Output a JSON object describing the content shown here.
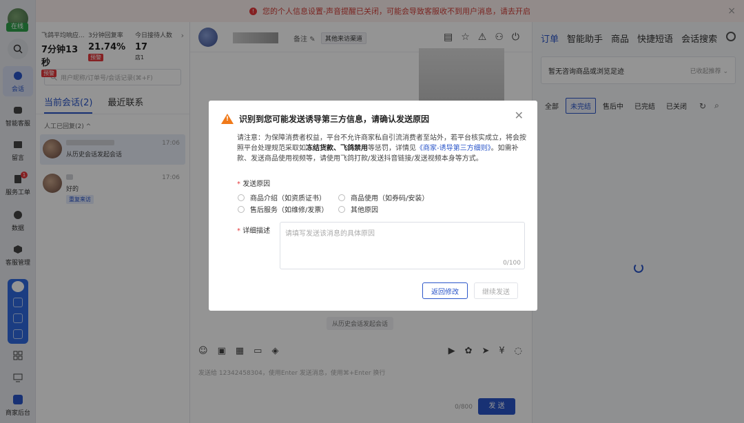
{
  "status": {
    "online": "在线"
  },
  "rail": [
    {
      "label": "会话",
      "icon": "chat-icon"
    },
    {
      "label": "智能客服",
      "icon": "ai-icon"
    },
    {
      "label": "留言",
      "icon": "mail-icon"
    },
    {
      "label": "服务工单",
      "icon": "ticket-icon",
      "badge": "1"
    },
    {
      "label": "数据",
      "icon": "pie-chart-icon"
    },
    {
      "label": "客服管理",
      "icon": "manage-icon"
    },
    {
      "label": "商家后台",
      "icon": "merchant-icon"
    }
  ],
  "topbar": {
    "message": "您的个人信息设置-声音提醒已关闭，可能会导致客服收不到用户消息，请去开启"
  },
  "stats": [
    {
      "label": "飞鸽平均响应...",
      "value": "7分钟13秒",
      "tag": "预警"
    },
    {
      "label": "3分钟回复率",
      "value": "21.74%",
      "tag": "预警"
    },
    {
      "label": "今日接待人数",
      "value": "17",
      "tag": "店1"
    }
  ],
  "search": {
    "placeholder": "用户昵称/订单号/会话记录(⌘+F)"
  },
  "tabs": {
    "current": "当前会话(2)",
    "recent": "最近联系"
  },
  "group": {
    "label": "人工已回复(2) ^"
  },
  "conversations": [
    {
      "message": "从历史会话发起会话",
      "time": "17:06"
    },
    {
      "message": "好的",
      "time": "17:06",
      "tag": "重复来访"
    }
  ],
  "chat": {
    "note": "备注",
    "channel": "其他来访渠道",
    "history_pill": "从历史会话发起会话",
    "input_placeholder": "发送给 12342458304，使用Enter 发送消息，使用⌘+Enter 换行",
    "count": "0/800",
    "send": "发 送"
  },
  "right": {
    "tabs": [
      "订单",
      "智能助手",
      "商品",
      "快捷短语",
      "会话搜索"
    ],
    "no_goods": "暂无咨询商品或浏览足迹",
    "recommend": "已收起推荐",
    "filters": [
      "全部",
      "未完结",
      "售后中",
      "已完结",
      "已关闭"
    ]
  },
  "modal": {
    "title": "识别到您可能发送诱导第三方信息，请确认发送原因",
    "notice_1": "请注意：为保障消费者权益，平台不允许商家私自引流消费者至站外，若平台核实成立，将会按照平台处理规范采取如",
    "notice_bold": "冻结货款、飞鸽禁用",
    "notice_2": "等惩罚，详情见",
    "notice_link": "《商家-诱导第三方细则》",
    "notice_3": "。如需补款、发送商品使用视频等，请使用飞鸽打款/发送抖音链接/发送视频本身等方式。",
    "reason_label": "发送原因",
    "reasons": [
      "商品介绍（如资质证书）",
      "商品使用（如券码/安装）",
      "售后服务（如维修/发票）",
      "其他原因"
    ],
    "detail_label": "详细描述",
    "detail_placeholder": "请填写发送该消息的具体原因",
    "detail_count": "0/100",
    "back": "返回修改",
    "continue": "继续发送"
  }
}
